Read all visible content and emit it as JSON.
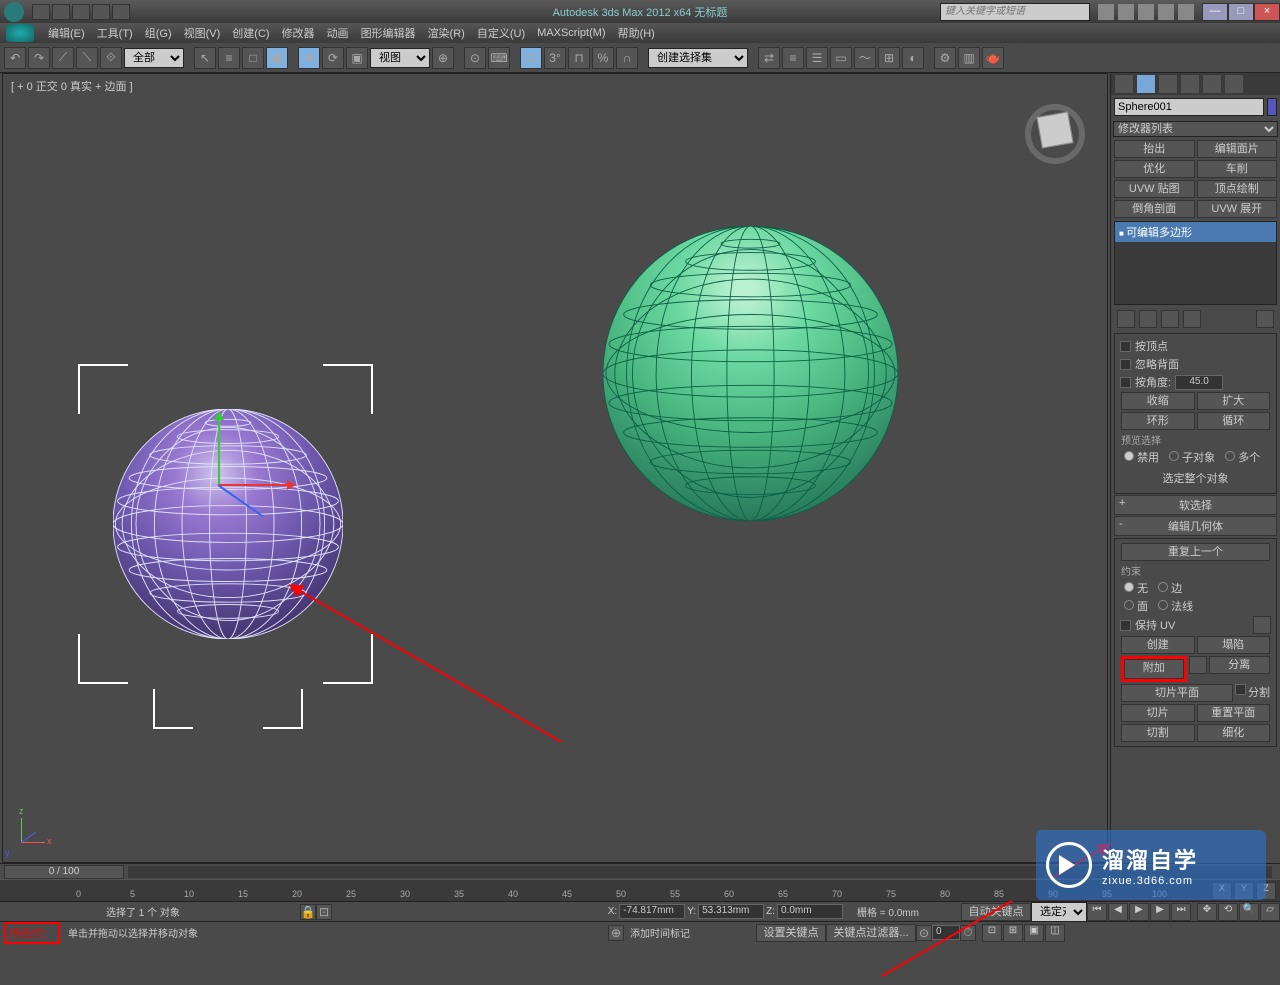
{
  "title": "Autodesk 3ds Max  2012 x64   无标题",
  "search_placeholder": "键入关键字或短语",
  "menu": [
    "编辑(E)",
    "工具(T)",
    "组(G)",
    "视图(V)",
    "创建(C)",
    "修改器",
    "动画",
    "图形编辑器",
    "渲染(R)",
    "自定义(U)",
    "MAXScript(M)",
    "帮助(H)"
  ],
  "toolbar": {
    "filter_all": "全部",
    "view_label": "视图",
    "named_sel": "创建选择集"
  },
  "viewport": {
    "label": "[ + 0 正交 0 真实 + 边面 ]",
    "axes": {
      "x": "x",
      "y": "y",
      "z": "z"
    }
  },
  "sidepanel": {
    "object_name": "Sphere001",
    "mod_list_label": "修改器列表",
    "mod_buttons": [
      [
        "抬出",
        "编辑面片"
      ],
      [
        "优化",
        "车削"
      ],
      [
        "UVW 贴图",
        "顶点绘制"
      ],
      [
        "倒角剖面",
        "UVW 展开"
      ]
    ],
    "stack_item": "可编辑多边形",
    "selection": {
      "by_vertex": "按顶点",
      "ignore_backfacing": "忽略背面",
      "by_angle": "按角度:",
      "angle_val": "45.0",
      "shrink": "收缩",
      "grow": "扩大",
      "ring": "环形",
      "loop": "循环",
      "preview_label": "预览选择",
      "disable": "禁用",
      "subobj": "子对象",
      "multi": "多个",
      "select_whole": "选定整个对象"
    },
    "rollouts": {
      "soft_sel": "软选择",
      "edit_geom": "编辑几何体",
      "repeat_last": "重复上一个",
      "constraints_label": "约束",
      "c_none": "无",
      "c_edge": "边",
      "c_face": "面",
      "c_normal": "法线",
      "preserve_uv": "保持 UV",
      "create": "创建",
      "collapse": "塌陷",
      "attach": "附加",
      "detach": "分离",
      "slice_plane": "切片平面",
      "split": "分割",
      "slice": "切片",
      "reset_plane": "重置平面",
      "quickslice": "切割",
      "msmooth": "细化"
    }
  },
  "timeline": {
    "frame_label": "0 / 100",
    "ticks": [
      "0",
      "5",
      "10",
      "15",
      "20",
      "25",
      "30",
      "35",
      "40",
      "45",
      "50",
      "55",
      "60",
      "65",
      "70",
      "75",
      "80",
      "85",
      "90",
      "95",
      "100"
    ]
  },
  "status": {
    "sel_count": "选择了 1 个 对象",
    "x": "X:",
    "xv": "-74.817mm",
    "y": "Y:",
    "yv": "53.313mm",
    "z": "Z:",
    "zv": "0.0mm",
    "grid": "栅格 = 0.0mm",
    "autokey": "自动关键点",
    "selset": "选定对",
    "xyz_lbl": [
      "X",
      "Y",
      "Z"
    ],
    "prompt": "单击并拖动以选择并移动对象",
    "add_time": "添加时间标记",
    "set_key": "设置关键点",
    "key_filters": "关键点过滤器...",
    "cur_frame": "0",
    "location_label": "所在行："
  },
  "watermark": {
    "t1": "溜溜自学",
    "t2": "zixue.3d66.com"
  }
}
